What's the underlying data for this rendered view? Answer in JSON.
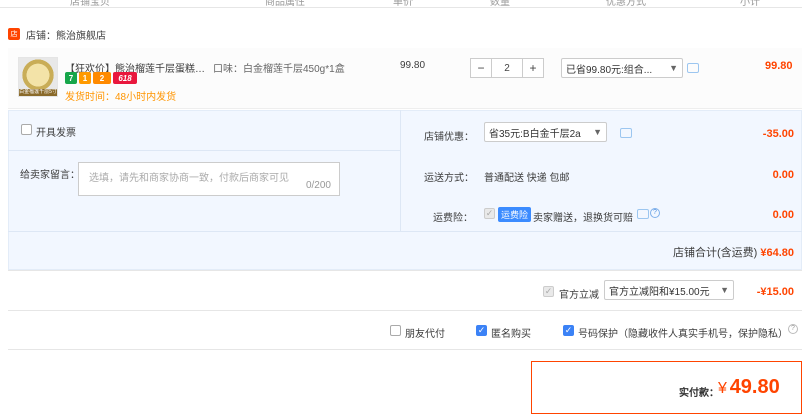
{
  "header": {
    "columns": [
      "店铺宝贝",
      "商品属性",
      "单价",
      "数量",
      "优惠方式",
      "小计"
    ]
  },
  "shop": {
    "label": "店铺：",
    "name": "熊治旗舰店",
    "icon": "shop-icon"
  },
  "item": {
    "title": "【狂欢价】熊治榴莲千层蛋糕白...",
    "spec": "口味：白金榴莲千层450g*1盒",
    "thumb_caption": "白金榴莲千层5寸",
    "badges": [
      "7",
      "1",
      "2",
      "618"
    ],
    "shipping": "发货时间：48小时内发货",
    "price": "99.80",
    "qty_minus": "−",
    "quantity": "2",
    "qty_plus": "+",
    "discount_select": "已省99.80元:组合...",
    "subtotal": "99.80"
  },
  "invoice": {
    "label": "开具发票"
  },
  "message": {
    "label": "给卖家留言：",
    "placeholder": "选填，请先和商家协商一致，付款后商家可见",
    "counter": "0/200"
  },
  "store_coupon": {
    "label": "店铺优惠：",
    "select": "省35元:B白金千层2a",
    "value": "-35.00"
  },
  "delivery": {
    "label": "运送方式：",
    "value": "普通配送 快递 包邮",
    "price": "0.00"
  },
  "insurance": {
    "label": "运费险：",
    "tag": "运费险",
    "desc": "卖家赠送，退换货可赔",
    "price": "0.00"
  },
  "store_total": {
    "label": "店铺合计(含运费)",
    "value": "¥64.80"
  },
  "official": {
    "label": "官方立减",
    "select": "官方立减阳和¥15.00元",
    "value": "-¥15.00"
  },
  "options": {
    "friend_pay": "朋友代付",
    "anonymous": "匿名购买",
    "privacy": "号码保护（隐藏收件人真实手机号，保护隐私）"
  },
  "pay": {
    "label": "实付款：",
    "currency": "¥",
    "amount": "49.80"
  },
  "colors": {
    "accent": "#ff4400",
    "blue_bg": "#f2f7ff",
    "checkbox_blue": "#3b82f6"
  }
}
